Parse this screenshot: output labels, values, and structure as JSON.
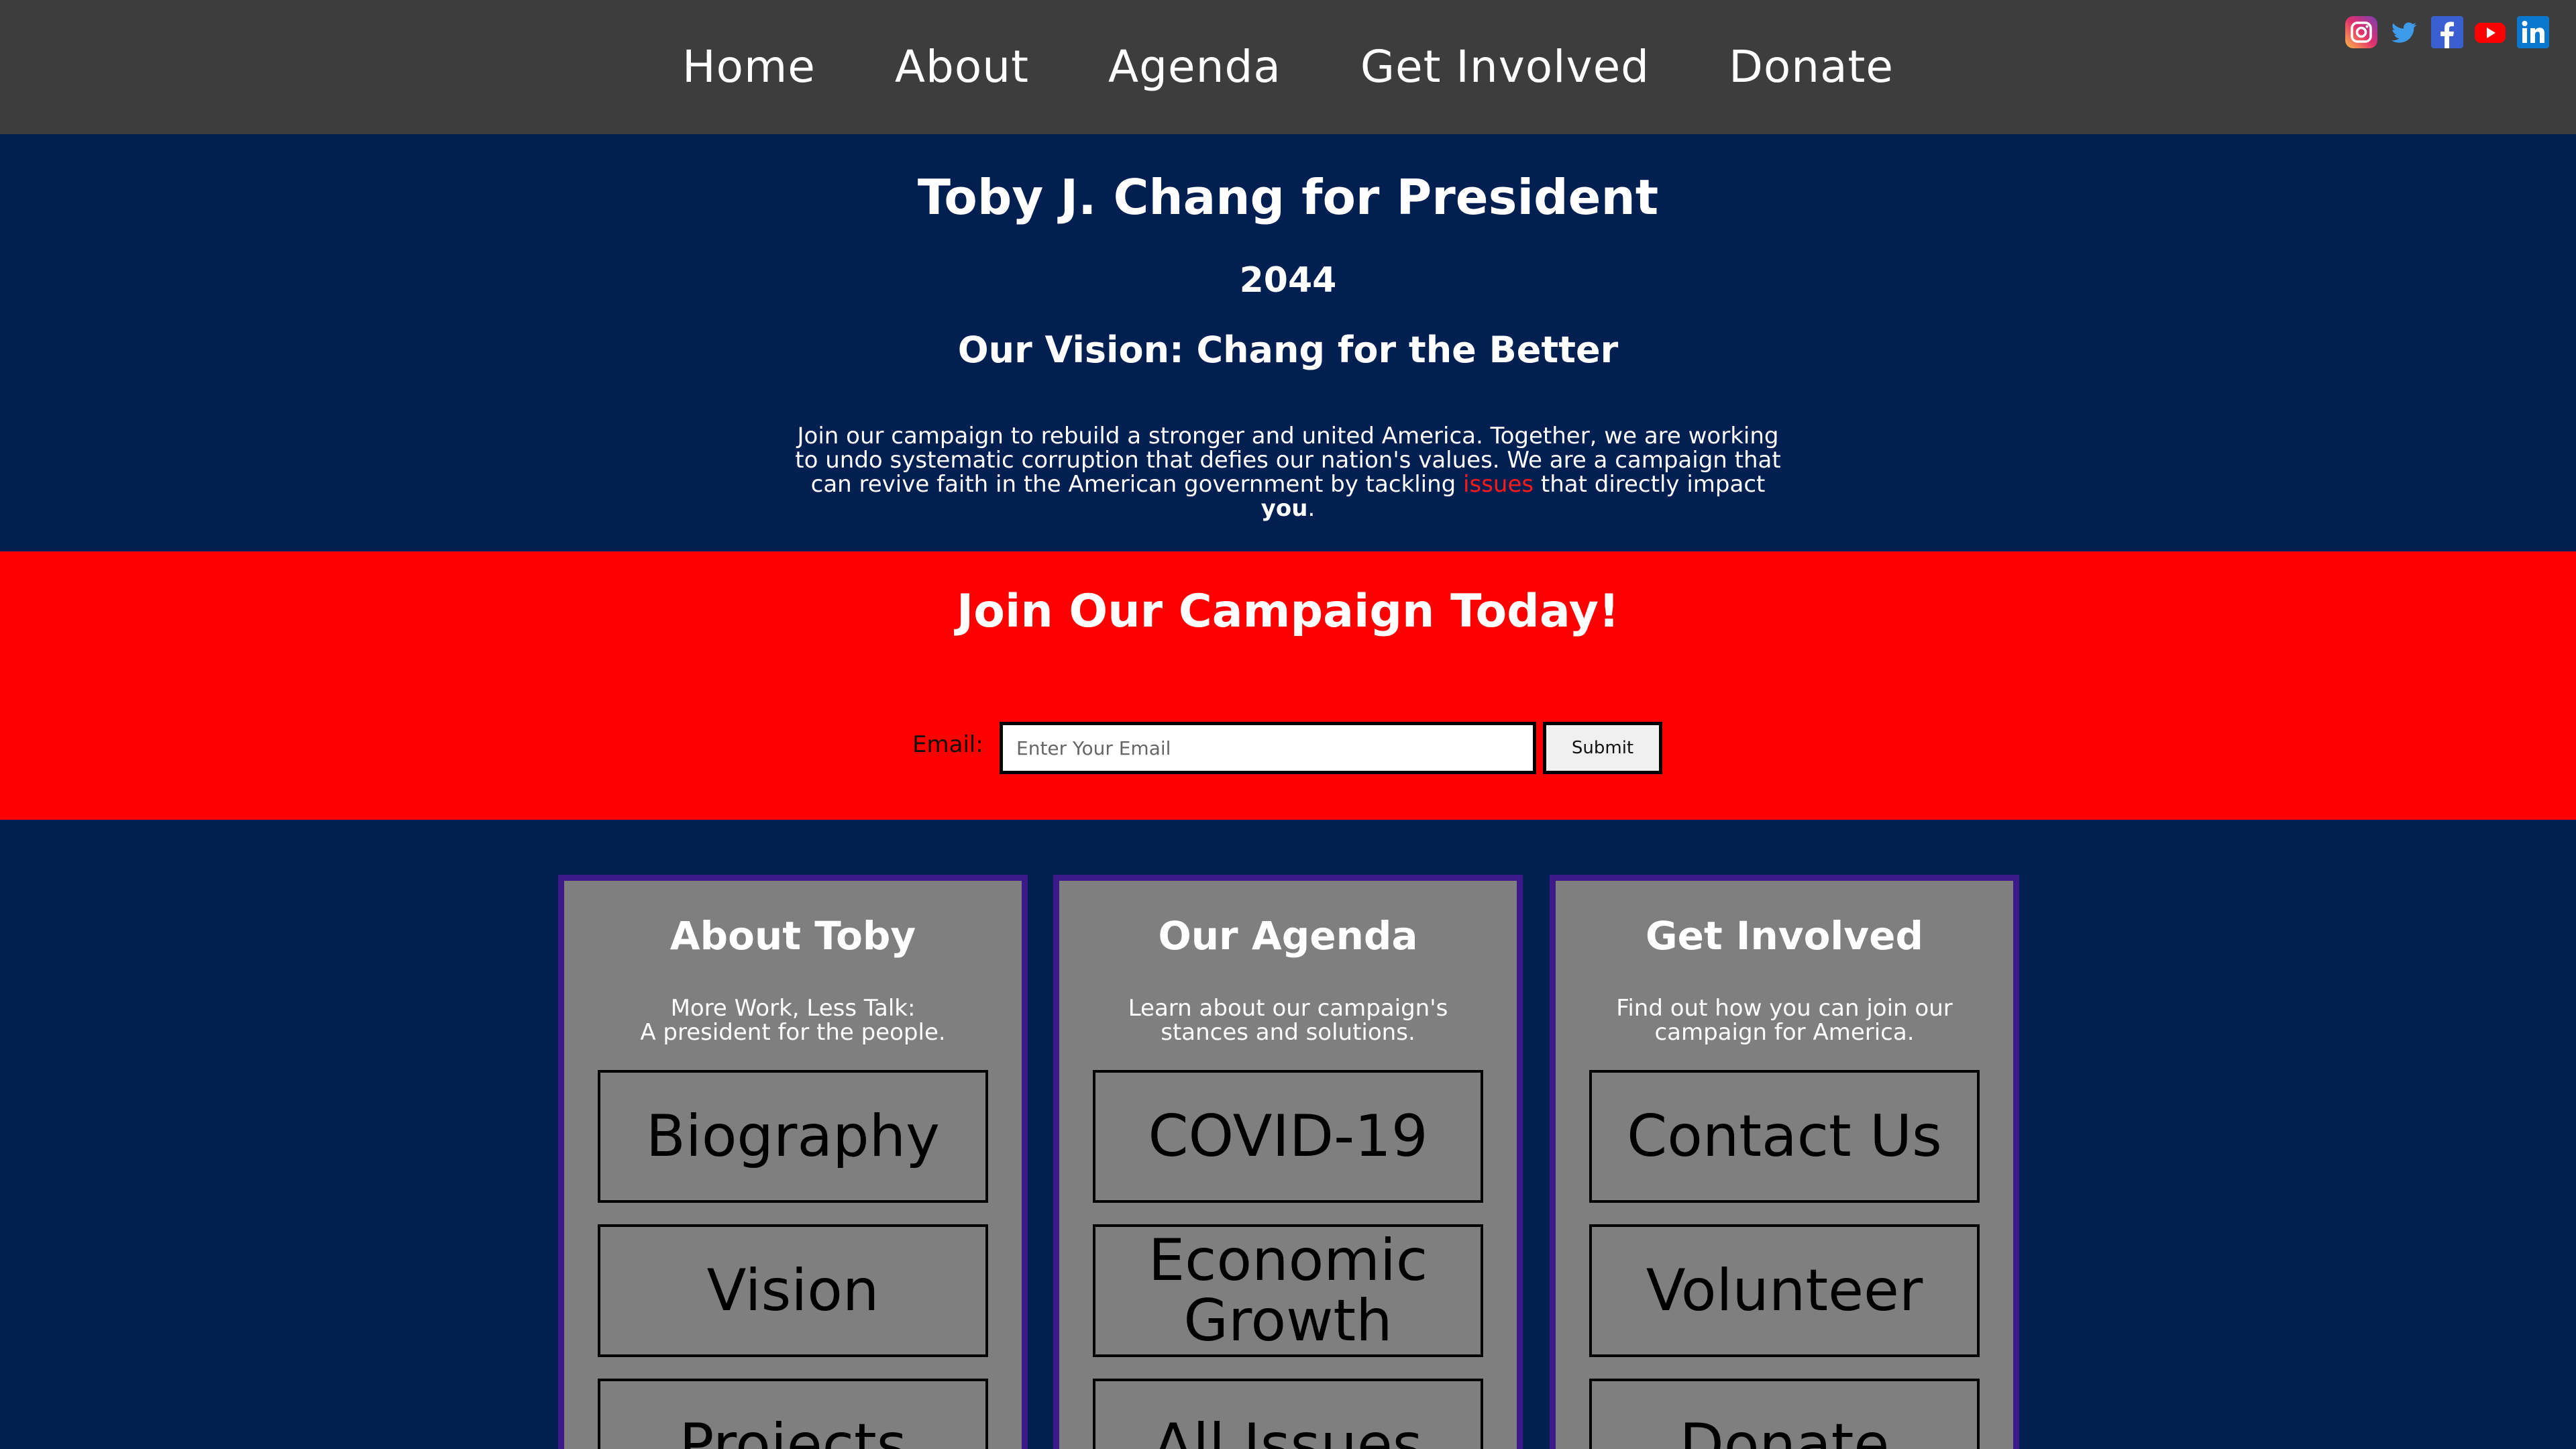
{
  "nav": {
    "links": [
      "Home",
      "About",
      "Agenda",
      "Get Involved",
      "Donate"
    ],
    "socials": [
      "instagram-icon",
      "twitter-icon",
      "facebook-icon",
      "youtube-icon",
      "linkedin-icon"
    ]
  },
  "hero": {
    "title": "Toby J. Chang for President",
    "year": "2044",
    "vision": "Our Vision: Chang for the Better",
    "blurb_part1": "Join our campaign to rebuild a stronger and united America. Together, we are working to undo systematic corruption that defies our nation's values. We are a campaign that can revive faith in the American government by tackling ",
    "blurb_link": "issues",
    "blurb_part2": " that directly impact ",
    "blurb_you": "you",
    "blurb_end": "."
  },
  "join": {
    "title": "Join Our Campaign Today!",
    "email_label": "Email:",
    "email_placeholder": "Enter Your Email",
    "email_value": "",
    "submit_label": "Submit"
  },
  "cards": [
    {
      "title": "About Toby",
      "subtitle_line1": "More Work, Less Talk:",
      "subtitle_line2": "A president for the people.",
      "buttons": [
        "Biography",
        "Vision",
        "Projects"
      ]
    },
    {
      "title": "Our Agenda",
      "subtitle_line1": "Learn about our campaign's",
      "subtitle_line2": "stances and solutions.",
      "buttons": [
        "COVID-19",
        "Economic Growth",
        "All Issues"
      ]
    },
    {
      "title": "Get Involved",
      "subtitle_line1": "Find out how you can join our",
      "subtitle_line2": "campaign for America.",
      "buttons": [
        "Contact Us",
        "Volunteer",
        "Donate"
      ]
    }
  ],
  "colors": {
    "nav_bg": "#3d3d3d",
    "hero_bg": "#021f52",
    "join_bg": "#ff0000",
    "card_bg": "#7f7f7f",
    "card_border": "#3d1a8a",
    "issues_link": "#ff1a1a"
  }
}
